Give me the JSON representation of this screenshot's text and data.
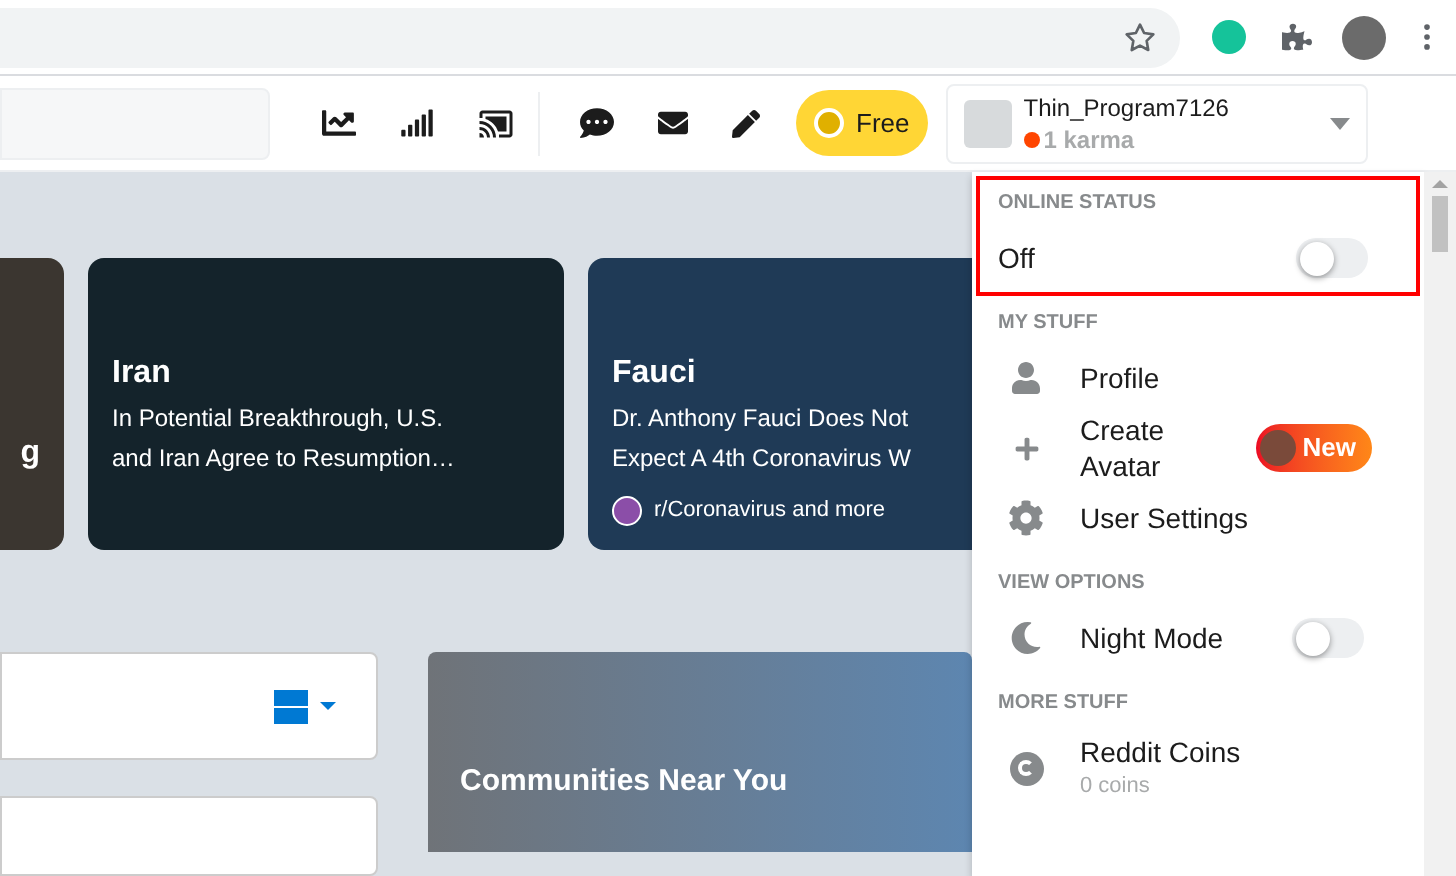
{
  "header": {
    "free_button": "Free",
    "user": {
      "name": "Thin_Program7126",
      "karma": "1 karma"
    }
  },
  "cards": [
    {
      "title": "g"
    },
    {
      "title": "Iran",
      "lines": [
        "In Potential Breakthrough, U.S.",
        "and Iran Agree to Resumption…"
      ]
    },
    {
      "title": "Fauci",
      "lines": [
        "Dr. Anthony Fauci Does Not",
        "Expect A 4th Coronavirus W"
      ],
      "source": "r/Coronavirus and more"
    }
  ],
  "communities_card": {
    "title": "Communities Near You"
  },
  "dropdown": {
    "sections": [
      {
        "heading": "ONLINE STATUS",
        "highlighted": true,
        "items": [
          {
            "kind": "toggle",
            "label": "Off",
            "on": false
          }
        ]
      },
      {
        "heading": "MY STUFF",
        "highlighted": false,
        "items": [
          {
            "kind": "link",
            "label": "Profile"
          },
          {
            "kind": "link",
            "label": "Create Avatar",
            "badge": "New"
          },
          {
            "kind": "link",
            "label": "User Settings"
          }
        ]
      },
      {
        "heading": "VIEW OPTIONS",
        "highlighted": false,
        "items": [
          {
            "kind": "toggle",
            "label": "Night Mode",
            "on": false
          }
        ]
      },
      {
        "heading": "MORE STUFF",
        "highlighted": false,
        "items": [
          {
            "kind": "link",
            "label": "Reddit Coins",
            "sub": "0 coins"
          }
        ]
      }
    ]
  }
}
